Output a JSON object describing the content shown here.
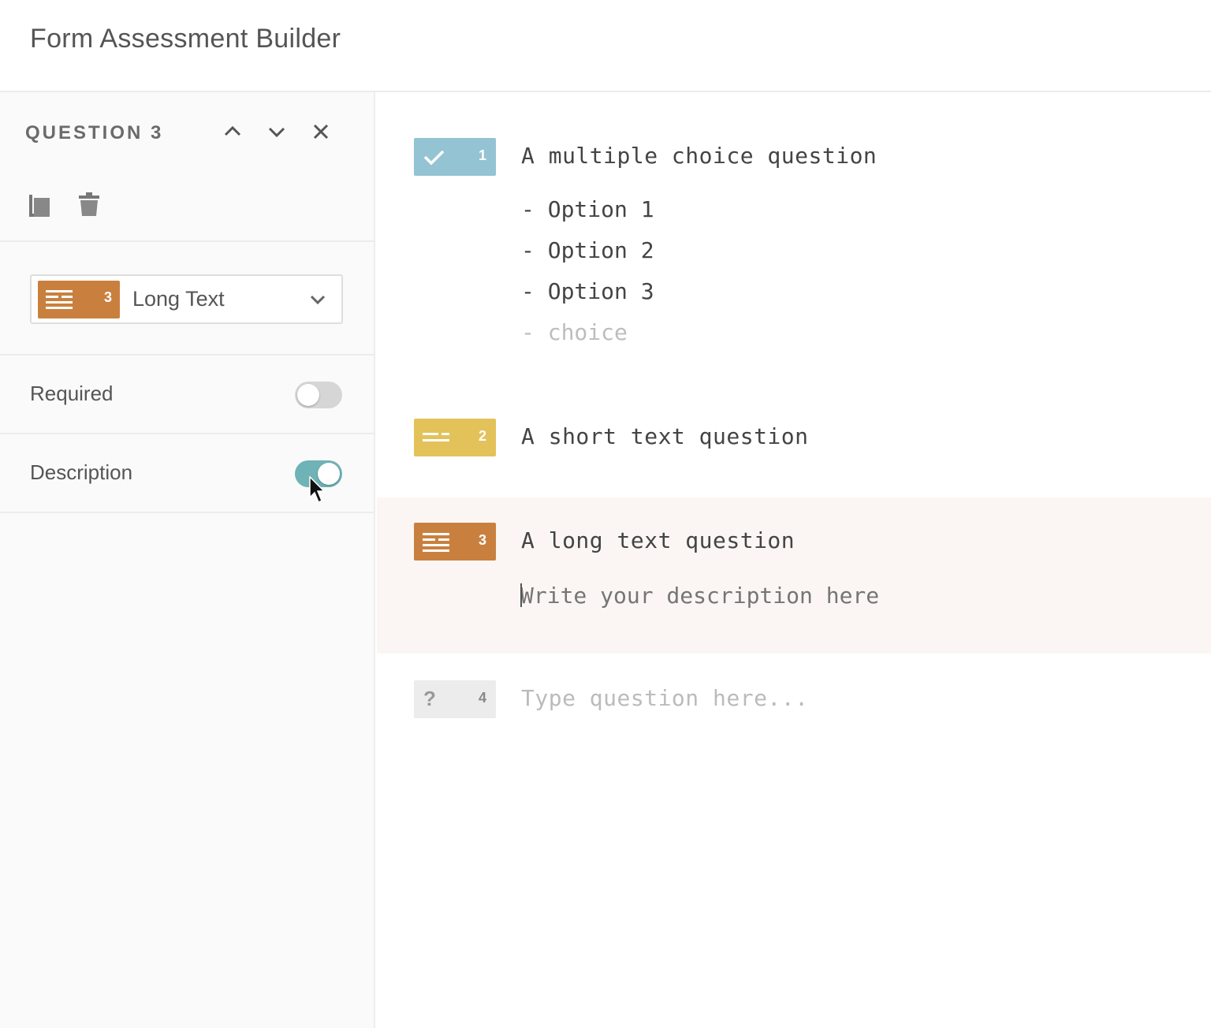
{
  "app": {
    "title": "Form Assessment Builder"
  },
  "sidebar": {
    "question_label": "QUESTION 3",
    "type_select": {
      "badge_number": "3",
      "selected": "Long Text"
    },
    "required": {
      "label": "Required",
      "enabled": false
    },
    "description": {
      "label": "Description",
      "enabled": true
    }
  },
  "questions": [
    {
      "number": "1",
      "type_icon": "check-icon",
      "color": "#94c3d3",
      "title": "A multiple choice question",
      "options": [
        "- Option 1",
        "- Option 2",
        "- Option 3"
      ],
      "new_option_placeholder": "- choice"
    },
    {
      "number": "2",
      "type_icon": "short-text-icon",
      "color": "#e3c25a",
      "title": "A short text question"
    },
    {
      "number": "3",
      "type_icon": "long-text-icon",
      "color": "#c9803e",
      "title": "A long text question",
      "description_placeholder": "Write your description here"
    },
    {
      "number": "4",
      "type_icon": "question-mark-icon",
      "color": "#ececec",
      "title_placeholder": "Type question here..."
    }
  ],
  "colors": {
    "accent_toggle": "#6fb3b6",
    "selected_row_bg": "#fbf6f3"
  }
}
